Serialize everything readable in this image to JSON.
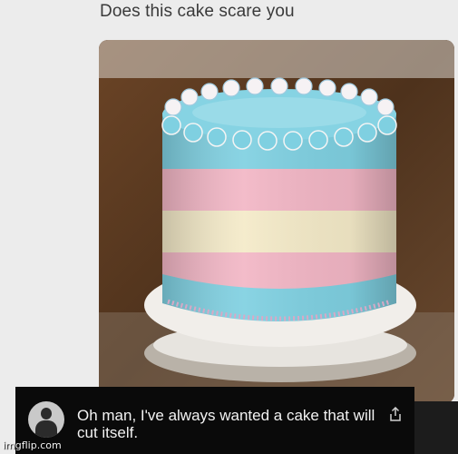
{
  "post": {
    "title": "Does this cake scare you"
  },
  "photo": {
    "subject": "cake-photo",
    "colors": {
      "blue": "#7fd0e1",
      "pink": "#f2b6c5",
      "cream": "#f4eac8",
      "backdrop": "#5a3a22"
    }
  },
  "comment": {
    "text": "Oh man, I've always wanted a cake that will cut itself.",
    "share_icon": "share-icon",
    "avatar_icon": "avatar-icon"
  },
  "watermark": {
    "text": "imgflip.com"
  }
}
